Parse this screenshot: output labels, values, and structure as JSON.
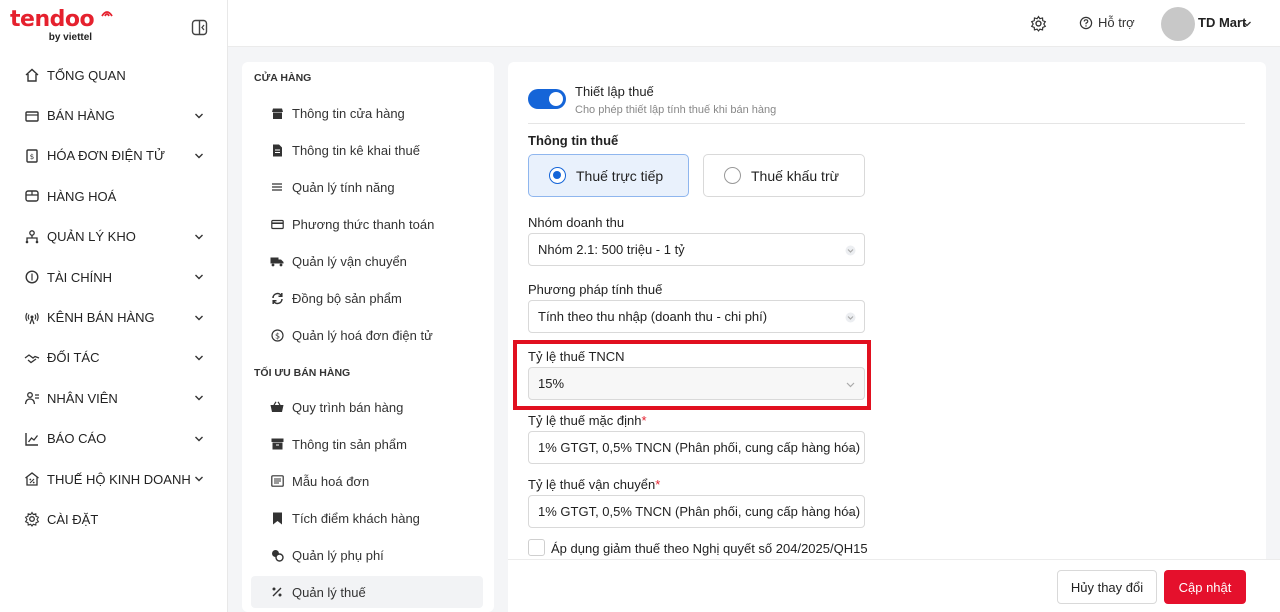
{
  "brand": {
    "logo_text": "tendoo",
    "logo_sub": "by viettel",
    "accent": "#e5212e",
    "primary": "#1565d8"
  },
  "sidebar": {
    "items": [
      {
        "label": "TỔNG QUAN",
        "icon": "home-icon",
        "expandable": false
      },
      {
        "label": "BÁN HÀNG",
        "icon": "cart-icon",
        "expandable": true
      },
      {
        "label": "HÓA ĐƠN ĐIỆN TỬ",
        "icon": "invoice-icon",
        "expandable": true
      },
      {
        "label": "HÀNG HOÁ",
        "icon": "box-icon",
        "expandable": false
      },
      {
        "label": "QUẢN LÝ KHO",
        "icon": "warehouse-icon",
        "expandable": true
      },
      {
        "label": "TÀI CHÍNH",
        "icon": "finance-icon",
        "expandable": true
      },
      {
        "label": "KÊNH BÁN HÀNG",
        "icon": "broadcast-icon",
        "expandable": true
      },
      {
        "label": "ĐỐI TÁC",
        "icon": "handshake-icon",
        "expandable": true
      },
      {
        "label": "NHÂN VIÊN",
        "icon": "staff-icon",
        "expandable": true
      },
      {
        "label": "BÁO CÁO",
        "icon": "chart-icon",
        "expandable": true
      },
      {
        "label": "THUẾ HỘ KINH DOANH",
        "icon": "tax-icon",
        "expandable": true
      },
      {
        "label": "CÀI ĐẶT",
        "icon": "gear-icon",
        "expandable": false
      }
    ]
  },
  "topbar": {
    "help_label": "Hỗ trợ",
    "user_name": "TD Mart"
  },
  "settings_menu": {
    "section_store": "CỬA HÀNG",
    "store_items": [
      {
        "label": "Thông tin cửa hàng",
        "icon": "store-icon"
      },
      {
        "label": "Thông tin kê khai thuế",
        "icon": "document-icon"
      },
      {
        "label": "Quản lý tính năng",
        "icon": "list-icon"
      },
      {
        "label": "Phương thức thanh toán",
        "icon": "card-icon"
      },
      {
        "label": "Quản lý vận chuyển",
        "icon": "truck-icon"
      },
      {
        "label": "Đồng bộ sản phẩm",
        "icon": "sync-icon"
      },
      {
        "label": "Quản lý hoá đơn điện tử",
        "icon": "dollar-icon"
      }
    ],
    "section_optimize": "TỐI ƯU BÁN HÀNG",
    "optimize_items": [
      {
        "label": "Quy trình bán hàng",
        "icon": "basket-icon"
      },
      {
        "label": "Thông tin sản phẩm",
        "icon": "archive-icon"
      },
      {
        "label": "Mẫu hoá đơn",
        "icon": "receipt-icon"
      },
      {
        "label": "Tích điểm khách hàng",
        "icon": "bookmark-icon"
      },
      {
        "label": "Quản lý phụ phí",
        "icon": "coins-icon"
      },
      {
        "label": "Quản lý thuế",
        "icon": "percent-icon",
        "active": true
      }
    ]
  },
  "form": {
    "toggle_title": "Thiết lập thuế",
    "toggle_desc": "Cho phép thiết lập tính thuế khi bán hàng",
    "toggle_on": true,
    "tax_info_label": "Thông tin thuế",
    "tax_types": [
      {
        "label": "Thuế trực tiếp",
        "selected": true
      },
      {
        "label": "Thuế khấu trừ",
        "selected": false
      }
    ],
    "revenue_group_label": "Nhóm doanh thu",
    "revenue_group_value": "Nhóm 2.1: 500 triệu - 1 tỷ",
    "tax_method_label": "Phương pháp tính thuế",
    "tax_method_value": "Tính theo thu nhập (doanh thu - chi phí)",
    "pit_rate_label": "Tỷ lệ thuế TNCN",
    "pit_rate_value": "15%",
    "default_rate_label": "Tỷ lệ thuế mặc định",
    "default_rate_value": "1% GTGT, 0,5% TNCN (Phân phối, cung cấp hàng hóa)",
    "shipping_rate_label": "Tỷ lệ thuế vận chuyển",
    "shipping_rate_value": "1% GTGT, 0,5% TNCN (Phân phối, cung cấp hàng hóa)",
    "required_mark": "*",
    "reduction_checkbox_label": "Áp dụng giảm thuế theo Nghị quyết số 204/2025/QH15",
    "reduction_checked": false
  },
  "footer": {
    "cancel_label": "Hủy thay đổi",
    "save_label": "Cập nhật"
  }
}
